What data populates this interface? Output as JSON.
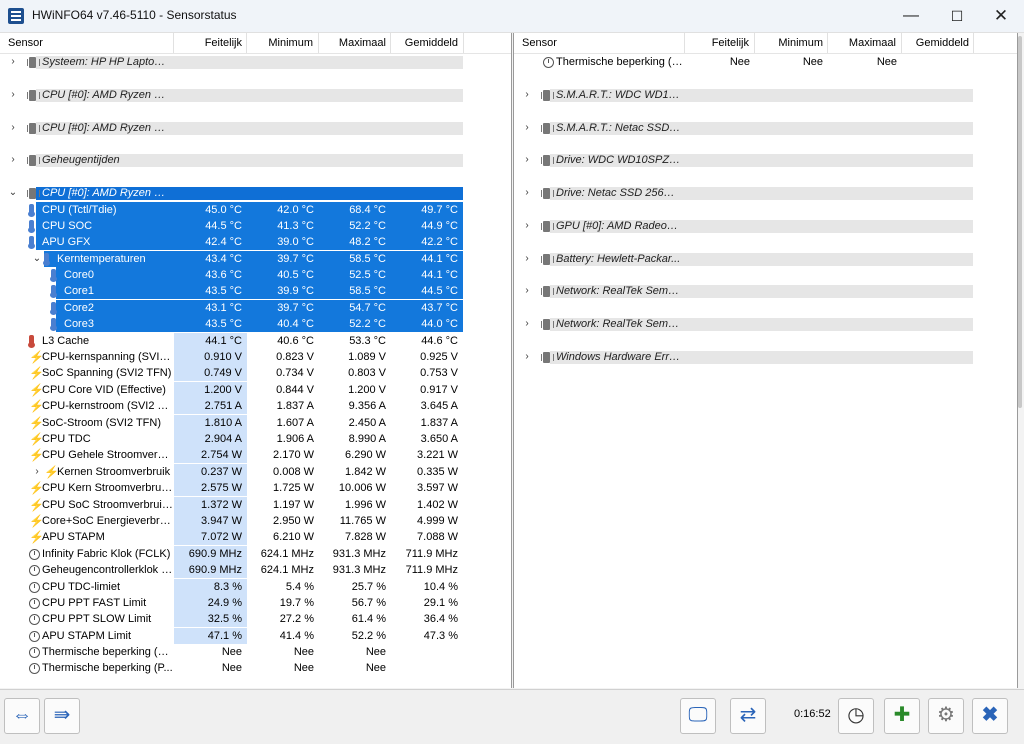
{
  "window": {
    "title": "HWiNFO64 v7.46-5110 - Sensorstatus"
  },
  "columns": {
    "sensor": "Sensor",
    "current": "Feitelijk",
    "min": "Minimum",
    "max": "Maximaal",
    "avg": "Gemiddeld"
  },
  "left_rows": [
    {
      "kind": "group",
      "chev": "›",
      "icon": "chip",
      "name": "Systeem: HP HP Laptop ..."
    },
    {
      "kind": "blank"
    },
    {
      "kind": "group",
      "chev": "›",
      "icon": "chip",
      "name": "CPU [#0]: AMD Ryzen 7 ..."
    },
    {
      "kind": "blank"
    },
    {
      "kind": "group",
      "chev": "›",
      "icon": "chip",
      "name": "CPU [#0]: AMD Ryzen 7 ..."
    },
    {
      "kind": "blank"
    },
    {
      "kind": "group",
      "chev": "›",
      "icon": "chip",
      "name": "Geheugentijden"
    },
    {
      "kind": "blank"
    },
    {
      "kind": "group",
      "chev": "⌄",
      "icon": "chip",
      "name": "CPU [#0]: AMD Ryzen 7 ...",
      "selected": true
    },
    {
      "kind": "data",
      "icon": "therm",
      "indent": 1,
      "name": "CPU (Tctl/Tdie)",
      "cur": "45.0 °C",
      "min": "42.0 °C",
      "max": "68.4 °C",
      "avg": "49.7 °C",
      "selected": true
    },
    {
      "kind": "data",
      "icon": "therm",
      "indent": 1,
      "name": "CPU SOC",
      "cur": "44.5 °C",
      "min": "41.3 °C",
      "max": "52.2 °C",
      "avg": "44.9 °C",
      "selected": true
    },
    {
      "kind": "data",
      "icon": "therm",
      "indent": 1,
      "name": "APU GFX",
      "cur": "42.4 °C",
      "min": "39.0 °C",
      "max": "48.2 °C",
      "avg": "42.2 °C",
      "selected": true
    },
    {
      "kind": "data",
      "chev": "⌄",
      "icon": "therm",
      "indent": 2,
      "name": "Kerntemperaturen",
      "cur": "43.4 °C",
      "min": "39.7 °C",
      "max": "58.5 °C",
      "avg": "44.1 °C",
      "selected": true
    },
    {
      "kind": "data",
      "icon": "therm",
      "indent": 3,
      "name": "Core0",
      "cur": "43.6 °C",
      "min": "40.5 °C",
      "max": "52.5 °C",
      "avg": "44.1 °C",
      "selected": true
    },
    {
      "kind": "data",
      "icon": "therm",
      "indent": 3,
      "name": "Core1",
      "cur": "43.5 °C",
      "min": "39.9 °C",
      "max": "58.5 °C",
      "avg": "44.5 °C",
      "selected": true
    },
    {
      "kind": "data",
      "icon": "therm",
      "indent": 3,
      "name": "Core2",
      "cur": "43.1 °C",
      "min": "39.7 °C",
      "max": "54.7 °C",
      "avg": "43.7 °C",
      "selected": true
    },
    {
      "kind": "data",
      "icon": "therm",
      "indent": 3,
      "name": "Core3",
      "cur": "43.5 °C",
      "min": "40.4 °C",
      "max": "52.2 °C",
      "avg": "44.0 °C",
      "selected": true
    },
    {
      "kind": "data",
      "icon": "therm-red",
      "indent": 1,
      "name": "L3 Cache",
      "cur": "44.1 °C",
      "min": "40.6 °C",
      "max": "53.3 °C",
      "avg": "44.6 °C"
    },
    {
      "kind": "data",
      "icon": "bolt",
      "indent": 1,
      "name": "CPU-kernspanning (SVI2 ...",
      "cur": "0.910 V",
      "min": "0.823 V",
      "max": "1.089 V",
      "avg": "0.925 V"
    },
    {
      "kind": "data",
      "icon": "bolt",
      "indent": 1,
      "name": "SoC Spanning (SVI2 TFN)",
      "cur": "0.749 V",
      "min": "0.734 V",
      "max": "0.803 V",
      "avg": "0.753 V"
    },
    {
      "kind": "data",
      "icon": "bolt",
      "indent": 1,
      "name": "CPU Core VID (Effective)",
      "cur": "1.200 V",
      "min": "0.844 V",
      "max": "1.200 V",
      "avg": "0.917 V"
    },
    {
      "kind": "data",
      "icon": "bolt",
      "indent": 1,
      "name": "CPU-kernstroom (SVI2 TFN)",
      "cur": "2.751 A",
      "min": "1.837 A",
      "max": "9.356 A",
      "avg": "3.645 A"
    },
    {
      "kind": "data",
      "icon": "bolt",
      "indent": 1,
      "name": "SoC-Stroom (SVI2 TFN)",
      "cur": "1.810 A",
      "min": "1.607 A",
      "max": "2.450 A",
      "avg": "1.837 A"
    },
    {
      "kind": "data",
      "icon": "bolt",
      "indent": 1,
      "name": "CPU TDC",
      "cur": "2.904 A",
      "min": "1.906 A",
      "max": "8.990 A",
      "avg": "3.650 A"
    },
    {
      "kind": "data",
      "icon": "bolt",
      "indent": 1,
      "name": "CPU Gehele Stroomverbruik",
      "cur": "2.754 W",
      "min": "2.170 W",
      "max": "6.290 W",
      "avg": "3.221 W"
    },
    {
      "kind": "data",
      "chev": "›",
      "icon": "bolt",
      "indent": 2,
      "name": "Kernen Stroomverbruik",
      "cur": "0.237 W",
      "min": "0.008 W",
      "max": "1.842 W",
      "avg": "0.335 W"
    },
    {
      "kind": "data",
      "icon": "bolt",
      "indent": 1,
      "name": "CPU Kern Stroomverbruik...",
      "cur": "2.575 W",
      "min": "1.725 W",
      "max": "10.006 W",
      "avg": "3.597 W"
    },
    {
      "kind": "data",
      "icon": "bolt",
      "indent": 1,
      "name": "CPU SoC Stroomverbruik ...",
      "cur": "1.372 W",
      "min": "1.197 W",
      "max": "1.996 W",
      "avg": "1.402 W"
    },
    {
      "kind": "data",
      "icon": "bolt",
      "indent": 1,
      "name": "Core+SoC Energieverbru...",
      "cur": "3.947 W",
      "min": "2.950 W",
      "max": "11.765 W",
      "avg": "4.999 W"
    },
    {
      "kind": "data",
      "icon": "bolt",
      "indent": 1,
      "name": "APU STAPM",
      "cur": "7.072 W",
      "min": "6.210 W",
      "max": "7.828 W",
      "avg": "7.088 W"
    },
    {
      "kind": "data",
      "icon": "clock",
      "indent": 1,
      "name": "Infinity Fabric Klok (FCLK)",
      "cur": "690.9 MHz",
      "min": "624.1 MHz",
      "max": "931.3 MHz",
      "avg": "711.9 MHz"
    },
    {
      "kind": "data",
      "icon": "clock",
      "indent": 1,
      "name": "Geheugencontrollerklok (...",
      "cur": "690.9 MHz",
      "min": "624.1 MHz",
      "max": "931.3 MHz",
      "avg": "711.9 MHz"
    },
    {
      "kind": "data",
      "icon": "clock",
      "indent": 1,
      "name": "CPU TDC-limiet",
      "cur": "8.3 %",
      "min": "5.4 %",
      "max": "25.7 %",
      "avg": "10.4 %"
    },
    {
      "kind": "data",
      "icon": "clock",
      "indent": 1,
      "name": "CPU PPT FAST Limit",
      "cur": "24.9 %",
      "min": "19.7 %",
      "max": "56.7 %",
      "avg": "29.1 %"
    },
    {
      "kind": "data",
      "icon": "clock",
      "indent": 1,
      "name": "CPU PPT SLOW Limit",
      "cur": "32.5 %",
      "min": "27.2 %",
      "max": "61.4 %",
      "avg": "36.4 %"
    },
    {
      "kind": "data",
      "icon": "clock",
      "indent": 1,
      "name": "APU STAPM Limit",
      "cur": "47.1 %",
      "min": "41.4 %",
      "max": "52.2 %",
      "avg": "47.3 %"
    },
    {
      "kind": "data",
      "icon": "clock",
      "indent": 1,
      "name": "Thermische beperking (H...",
      "cur": "Nee",
      "min": "Nee",
      "max": "Nee",
      "avg": "",
      "nocur": true
    },
    {
      "kind": "data",
      "icon": "clock",
      "indent": 1,
      "name": "Thermische beperking (P...",
      "cur": "Nee",
      "min": "Nee",
      "max": "Nee",
      "avg": "",
      "nocur": true
    }
  ],
  "right_rows": [
    {
      "kind": "data",
      "icon": "clock",
      "indent": 1,
      "name": "Thermische beperking (P...",
      "cur": "Nee",
      "min": "Nee",
      "max": "Nee",
      "avg": "",
      "nocur": true
    },
    {
      "kind": "blank"
    },
    {
      "kind": "group",
      "chev": "›",
      "icon": "chip",
      "name": "S.M.A.R.T.: WDC WD10..."
    },
    {
      "kind": "blank"
    },
    {
      "kind": "group",
      "chev": "›",
      "icon": "chip",
      "name": "S.M.A.R.T.: Netac SSD 2..."
    },
    {
      "kind": "blank"
    },
    {
      "kind": "group",
      "chev": "›",
      "icon": "chip",
      "name": "Drive: WDC WD10SPZX-..."
    },
    {
      "kind": "blank"
    },
    {
      "kind": "group",
      "chev": "›",
      "icon": "chip",
      "name": "Drive: Netac SSD 256GB ..."
    },
    {
      "kind": "blank"
    },
    {
      "kind": "group",
      "chev": "›",
      "icon": "chip",
      "name": "GPU [#0]: AMD Radeon ..."
    },
    {
      "kind": "blank"
    },
    {
      "kind": "group",
      "chev": "›",
      "icon": "chip",
      "name": "Battery: Hewlett-Packar..."
    },
    {
      "kind": "blank"
    },
    {
      "kind": "group",
      "chev": "›",
      "icon": "chip",
      "name": "Network: RealTek Semico..."
    },
    {
      "kind": "blank"
    },
    {
      "kind": "group",
      "chev": "›",
      "icon": "chip",
      "name": "Network: RealTek Semico..."
    },
    {
      "kind": "blank"
    },
    {
      "kind": "group",
      "chev": "›",
      "icon": "chip",
      "name": "Windows Hardware Error..."
    }
  ],
  "toolbar": {
    "timer": "0:16:52"
  },
  "colors": {
    "selected": "#1378dc",
    "current_col": "#cfe2fa",
    "group_bar": "#e6e6e6"
  }
}
